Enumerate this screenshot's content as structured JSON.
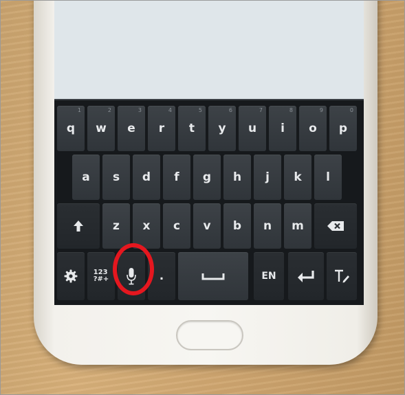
{
  "keyboard": {
    "row1": [
      {
        "label": "q",
        "hint": "1"
      },
      {
        "label": "w",
        "hint": "2"
      },
      {
        "label": "e",
        "hint": "3"
      },
      {
        "label": "r",
        "hint": "4"
      },
      {
        "label": "t",
        "hint": "5"
      },
      {
        "label": "y",
        "hint": "6"
      },
      {
        "label": "u",
        "hint": "7"
      },
      {
        "label": "i",
        "hint": "8"
      },
      {
        "label": "o",
        "hint": "9"
      },
      {
        "label": "p",
        "hint": "0"
      }
    ],
    "row2": [
      "a",
      "s",
      "d",
      "f",
      "g",
      "h",
      "j",
      "k",
      "l"
    ],
    "row3": [
      "z",
      "x",
      "c",
      "v",
      "b",
      "n",
      "m"
    ],
    "symbols_key": {
      "line1": "123",
      "line2": "?#+"
    },
    "period_key": ".",
    "language_key": "EN",
    "icons": {
      "settings": "gear-icon",
      "shift": "shift-arrow-icon",
      "backspace": "backspace-icon",
      "microphone": "microphone-icon",
      "space": "space-bar-icon",
      "enter": "enter-return-icon",
      "text_edit": "text-edit-icon"
    }
  },
  "colors": {
    "highlight_ring": "#e5171f",
    "key_face": "#353a3f",
    "key_text": "#e8eaec"
  }
}
